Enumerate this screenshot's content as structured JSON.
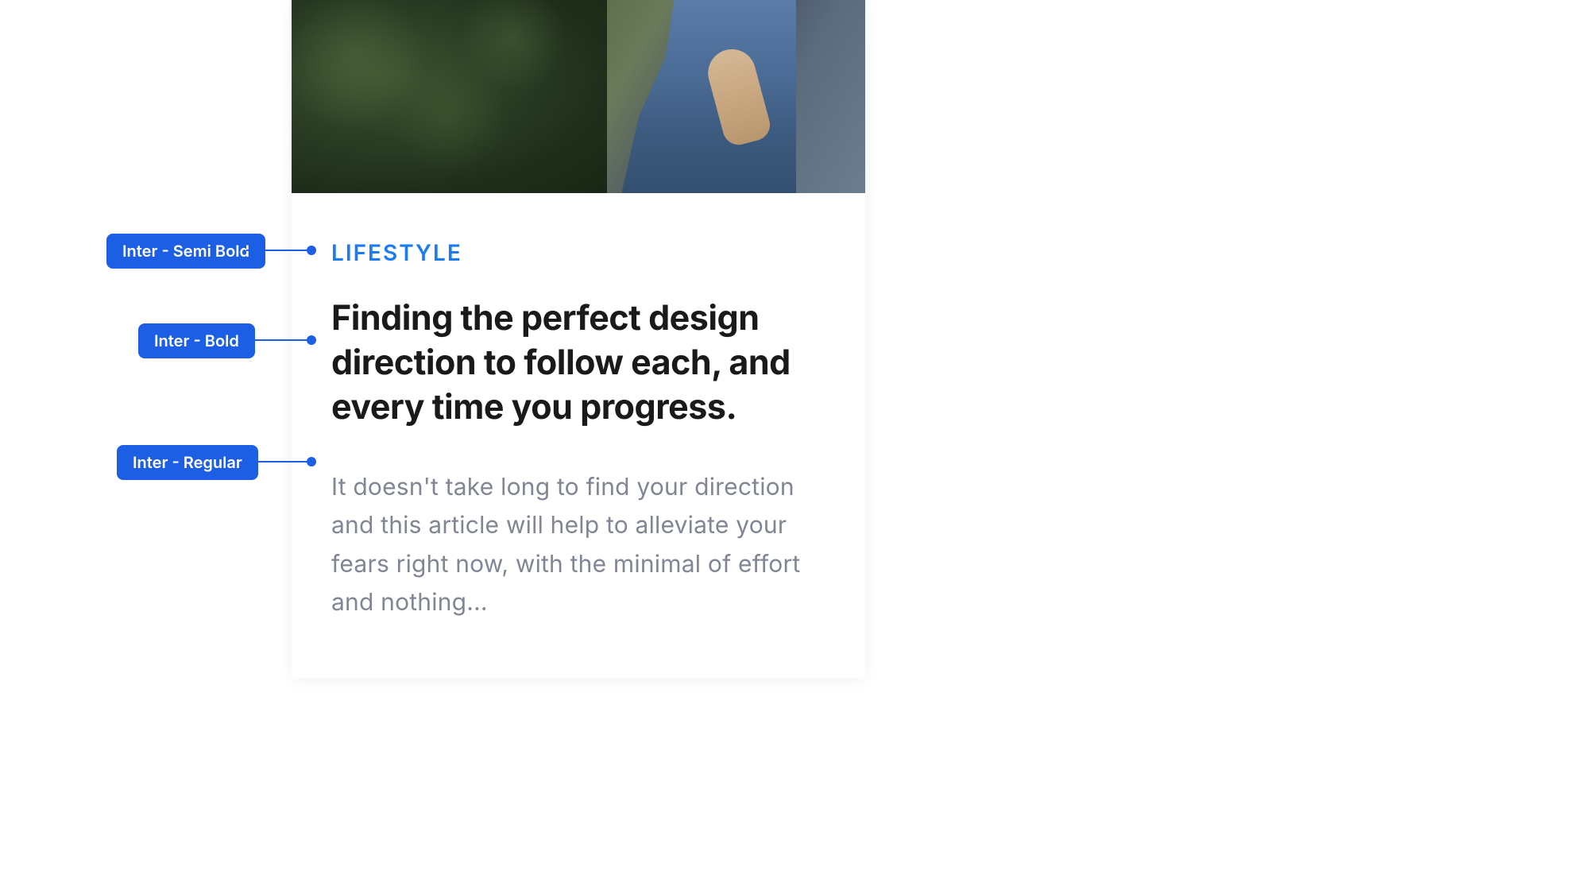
{
  "card": {
    "category": "LIFESTYLE",
    "title": "Finding the perfect design direction to follow each, and every time you progress.",
    "body": "It doesn't take long to find your direction and this article will help to alleviate your fears right now, with the minimal of effort and nothing..."
  },
  "annotations": {
    "category_font": "Inter - Semi Bold",
    "title_font": "Inter - Bold",
    "body_font": "Inter - Regular"
  },
  "colors": {
    "accent": "#1c5fe5",
    "category_text": "#1c7bf2",
    "title_text": "#1a1a1a",
    "body_text": "#808694"
  }
}
